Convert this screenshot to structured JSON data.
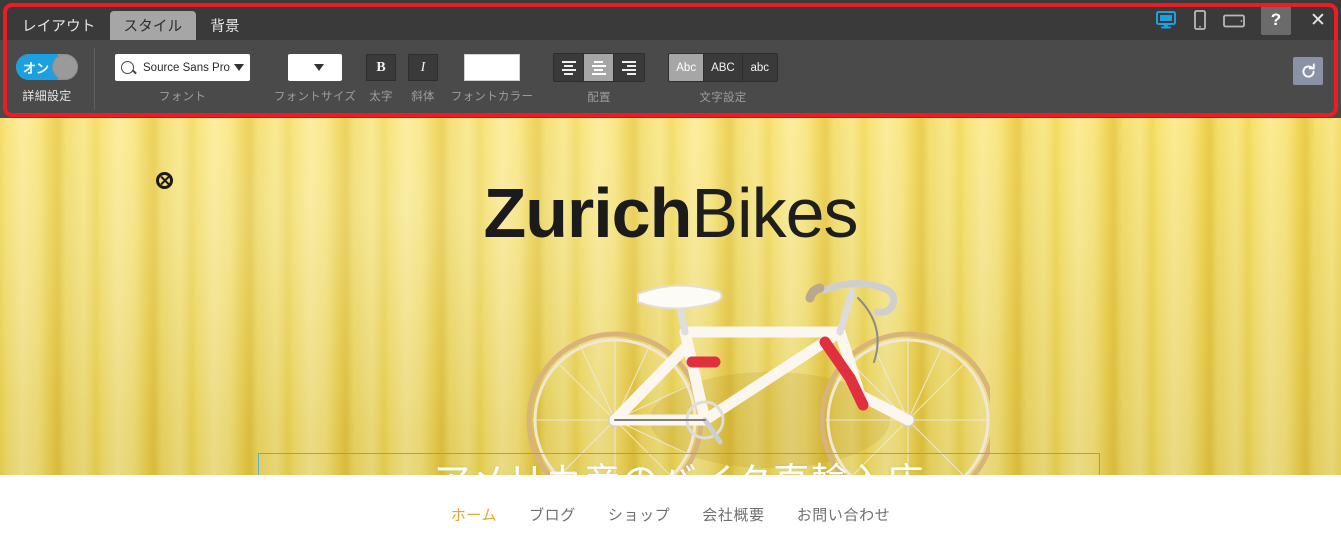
{
  "editor": {
    "tabs": [
      {
        "label": "レイアウト",
        "active": false
      },
      {
        "label": "スタイル",
        "active": true
      },
      {
        "label": "背景",
        "active": false
      }
    ],
    "device_buttons": [
      {
        "name": "desktop-view",
        "active": true
      },
      {
        "name": "mobile-view",
        "active": false
      },
      {
        "name": "tablet-view",
        "active": false
      }
    ],
    "help_label": "?",
    "close_label": "✕",
    "ribbon": {
      "advanced": {
        "toggle_state_label": "オン",
        "group_label": "詳細設定"
      },
      "font": {
        "value": "Source Sans Pro",
        "group_label": "フォント"
      },
      "font_size": {
        "value": "",
        "group_label": "フォントサイズ"
      },
      "bold": {
        "label": "B",
        "group_label": "太字"
      },
      "italic": {
        "label": "I",
        "group_label": "斜体"
      },
      "font_color": {
        "group_label": "フォントカラー",
        "swatch_color": "#ffffff"
      },
      "align": {
        "group_label": "配置",
        "options": [
          "left",
          "center",
          "right"
        ],
        "selected": "center"
      },
      "text_case": {
        "group_label": "文字設定",
        "options": [
          "Abc",
          "ABC",
          "abc"
        ],
        "selected": "Abc"
      },
      "reset_label": "reset"
    }
  },
  "site": {
    "logo": {
      "bold_part": "Zurich",
      "light_part": "Bikes"
    },
    "tagline": "アメリカ産のバイク直輸入店",
    "nav": [
      {
        "label": "ホーム",
        "active": true
      },
      {
        "label": "ブログ",
        "active": false
      },
      {
        "label": "ショップ",
        "active": false
      },
      {
        "label": "会社概要",
        "active": false
      },
      {
        "label": "お問い合わせ",
        "active": false
      }
    ]
  },
  "colors": {
    "accent_blue": "#1ba1e2",
    "highlight_red": "#ed1c24",
    "nav_active": "#f0a32a",
    "selection_outline": "#5bb3c9",
    "banner_yellow": "#f2d853"
  }
}
